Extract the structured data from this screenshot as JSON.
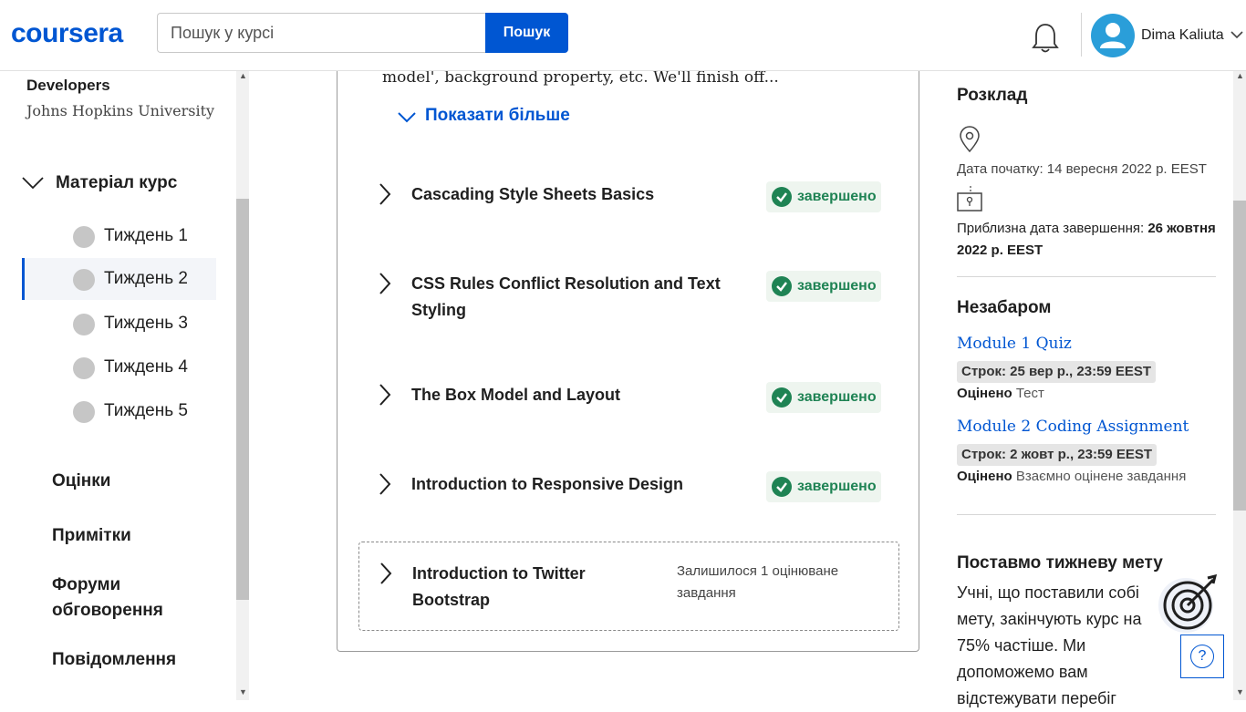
{
  "header": {
    "logo": "coursera",
    "search_placeholder": "Пошук у курсі",
    "search_button": "Пошук",
    "user_name": "Dima Kaliuta"
  },
  "sidebar": {
    "course_org": "Developers",
    "university": "Johns Hopkins University",
    "material_label": "Матеріал курс",
    "weeks": [
      "Тиждень 1",
      "Тиждень 2",
      "Тиждень 3",
      "Тиждень 4",
      "Тиждень 5"
    ],
    "active_week_index": 1,
    "links": [
      "Оцінки",
      "Примітки",
      "Форуми обговорення",
      "Повідомлення"
    ]
  },
  "main": {
    "desc_tail": "model', background property, etc. We'll finish off...",
    "show_more": "Показати більше",
    "lessons": [
      {
        "title": "Cascading Style Sheets Basics",
        "status": "завершено"
      },
      {
        "title": "CSS Rules Conflict Resolution and Text Styling",
        "status": "завершено"
      },
      {
        "title": "The Box Model and Layout",
        "status": "завершено"
      },
      {
        "title": "Introduction to Responsive Design",
        "status": "завершено"
      },
      {
        "title": "Introduction to Twitter Bootstrap",
        "status": "Залишилося 1 оцінюване завдання"
      }
    ]
  },
  "schedule": {
    "heading": "Розклад",
    "start_date": "Дата початку: 14 вересня 2022 р. EEST",
    "end_label": "Приблизна дата завершення:",
    "end_value": "26 жовтня 2022 р. EEST"
  },
  "upcoming": {
    "heading": "Незабаром",
    "items": [
      {
        "title": "Module 1 Quiz",
        "due": "Строк: 25 вер р., 23:59 EEST",
        "graded_label": "Оцінено",
        "graded_type": "Тест"
      },
      {
        "title": "Module 2 Coding Assignment",
        "due": "Строк: 2 жовт р., 23:59 EEST",
        "graded_label": "Оцінено",
        "graded_type": "Взаємно оцінене завдання"
      }
    ]
  },
  "goal": {
    "heading": "Поставмо тижневу мету",
    "text": "Учні, що поставили собі мету, закінчують курс на 75% частіше. Ми допоможемо вам відстежувати перебіг"
  },
  "help_label": "?",
  "colors": {
    "brand": "#0056d2",
    "success": "#1f8354"
  }
}
